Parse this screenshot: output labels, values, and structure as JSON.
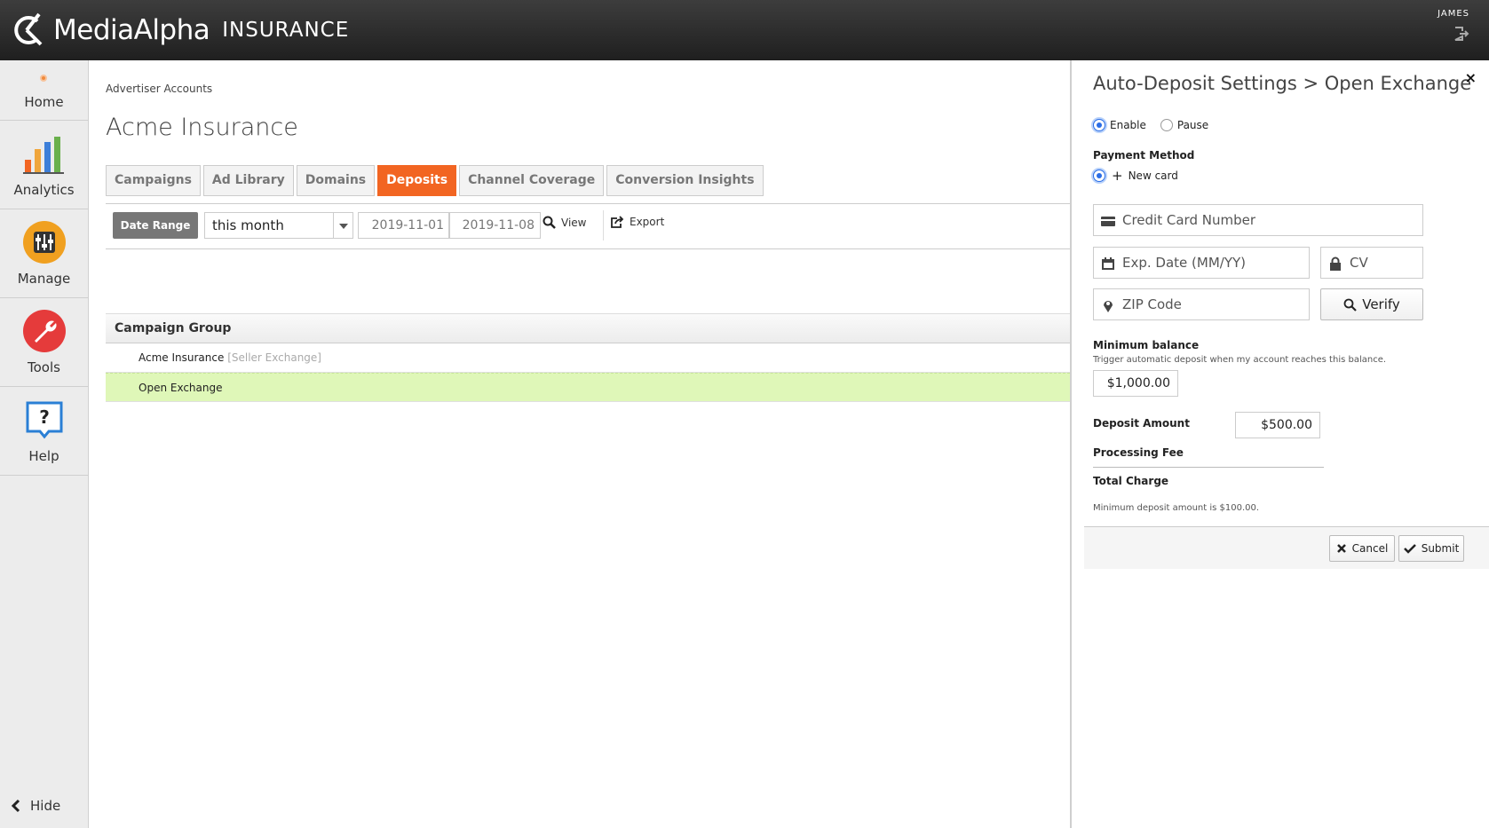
{
  "brand": {
    "name": "MediaAlpha",
    "product": "INSURANCE"
  },
  "user": {
    "name": "JAMES"
  },
  "sidebar": {
    "items": [
      {
        "label": "Home",
        "icon": "home-dot-icon"
      },
      {
        "label": "Analytics",
        "icon": "bar-chart-icon"
      },
      {
        "label": "Manage",
        "icon": "sliders-icon"
      },
      {
        "label": "Tools",
        "icon": "wrench-icon"
      },
      {
        "label": "Help",
        "icon": "question-icon"
      }
    ],
    "hide_label": "Hide"
  },
  "breadcrumb": "Advertiser Accounts",
  "page_title": "Acme Insurance",
  "tabs": [
    {
      "label": "Campaigns"
    },
    {
      "label": "Ad Library"
    },
    {
      "label": "Domains"
    },
    {
      "label": "Deposits",
      "active": true
    },
    {
      "label": "Channel Coverage"
    },
    {
      "label": "Conversion Insights"
    }
  ],
  "toolbar": {
    "date_range_label": "Date Range",
    "range_value": "this month",
    "start_date": "2019-11-01",
    "end_date": "2019-11-08",
    "view_label": "View",
    "export_label": "Export"
  },
  "table": {
    "header": "Campaign Group",
    "rows": [
      {
        "name": "Acme Insurance",
        "tag": "[Seller Exchange]"
      },
      {
        "name": "Open Exchange",
        "tag": ""
      }
    ]
  },
  "panel": {
    "title": "Auto-Deposit Settings > Open Exchange",
    "close": "×",
    "enable_label": "Enable",
    "pause_label": "Pause",
    "payment_method_label": "Payment Method",
    "new_card_label": "New card",
    "cc_placeholder": "Credit Card Number",
    "exp_placeholder": "Exp. Date (MM/YY)",
    "cv_placeholder": "CV",
    "zip_placeholder": "ZIP Code",
    "verify_label": "Verify",
    "min_balance_label": "Minimum balance",
    "min_balance_help": "Trigger automatic deposit when my account reaches this balance.",
    "min_balance_value": "$1,000.00",
    "deposit_amount_label": "Deposit Amount",
    "deposit_amount_value": "$500.00",
    "processing_fee_label": "Processing Fee",
    "total_charge_label": "Total Charge",
    "min_deposit_note": "Minimum deposit amount is $100.00.",
    "cancel_label": "Cancel",
    "submit_label": "Submit"
  },
  "colors": {
    "accent": "#f26522",
    "selected_row": "#dff7b8",
    "radio": "#2a6de5"
  }
}
